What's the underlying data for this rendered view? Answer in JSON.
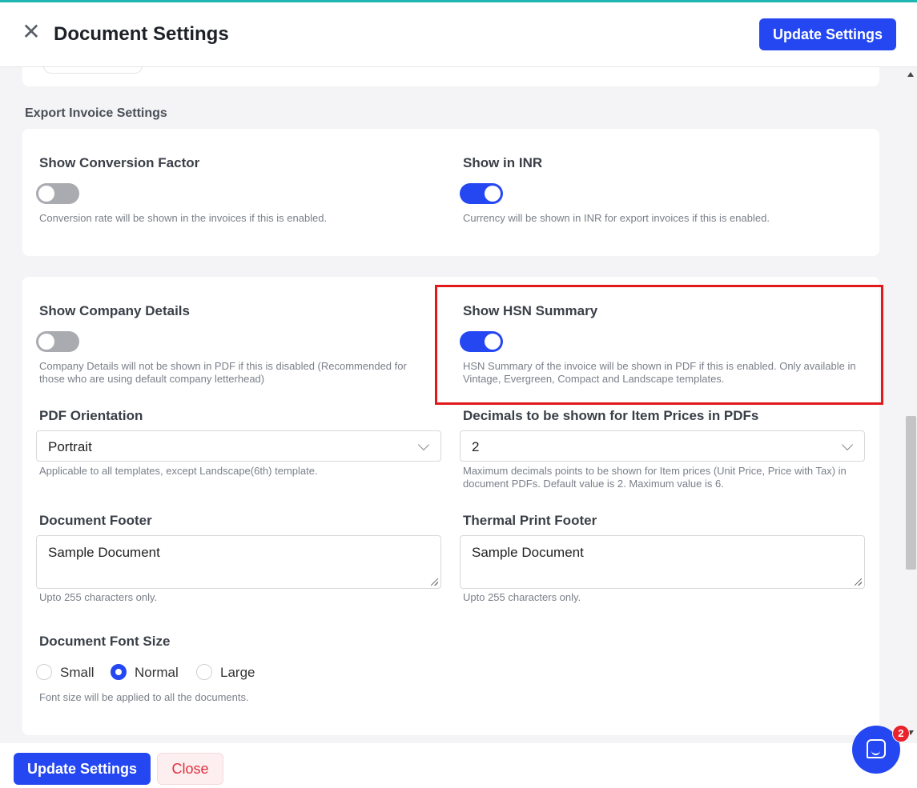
{
  "header": {
    "title": "Document Settings",
    "update_label": "Update Settings"
  },
  "colors": {
    "accent": "#2447f2",
    "top_bar": "#1fb5b0",
    "highlight": "#e0191b",
    "danger": "#e0303e"
  },
  "export_section": {
    "title": "Export Invoice Settings",
    "conversion_factor": {
      "label": "Show Conversion Factor",
      "enabled": false,
      "help": "Conversion rate will be shown in the invoices if this is enabled."
    },
    "show_in_inr": {
      "label": "Show in INR",
      "enabled": true,
      "help": "Currency will be shown in INR for export invoices if this is enabled."
    }
  },
  "main_section": {
    "company_details": {
      "label": "Show Company Details",
      "enabled": false,
      "help": "Company Details will not be shown in PDF if this is disabled (Recommended for those who are using default company letterhead)"
    },
    "hsn_summary": {
      "label": "Show HSN Summary",
      "enabled": true,
      "help": "HSN Summary of the invoice will be shown in PDF if this is enabled. Only available in Vintage, Evergreen, Compact and Landscape templates."
    },
    "pdf_orientation": {
      "label": "PDF Orientation",
      "value": "Portrait",
      "help": "Applicable to all templates, except Landscape(6th) template."
    },
    "decimals": {
      "label": "Decimals to be shown for Item Prices in PDFs",
      "value": "2",
      "help": "Maximum decimals points to be shown for Item prices (Unit Price, Price with Tax) in document PDFs. Default value is 2. Maximum value is 6."
    },
    "document_footer": {
      "label": "Document Footer",
      "value": "Sample Document",
      "help": "Upto 255 characters only."
    },
    "thermal_footer": {
      "label": "Thermal Print Footer",
      "value": "Sample Document",
      "help": "Upto 255 characters only."
    },
    "font_size": {
      "label": "Document Font Size",
      "options": [
        "Small",
        "Normal",
        "Large"
      ],
      "selected": "Normal",
      "help": "Font size will be applied to all the documents."
    }
  },
  "footer": {
    "update_label": "Update Settings",
    "close_label": "Close"
  },
  "chat": {
    "badge_count": "2",
    "icon": "chat-bubble-icon"
  }
}
